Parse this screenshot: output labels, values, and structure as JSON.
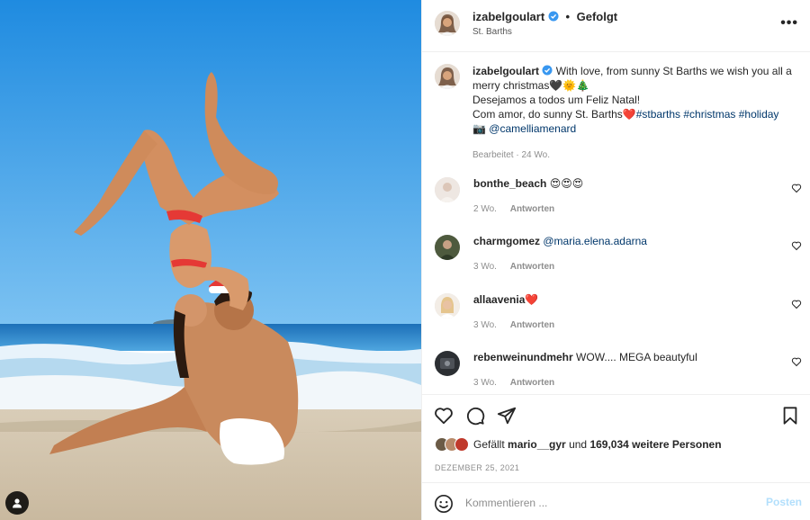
{
  "post": {
    "username": "izabelgoulart",
    "separator": "•",
    "follow_label": "Gefolgt",
    "location": "St. Barths",
    "more_icon": "more-horizontal-icon"
  },
  "caption": {
    "username": "izabelgoulart",
    "line1": " With love, from sunny St Barths we wish you all a merry christmas🖤🌞🎄",
    "line2": "Desejamos a todos um Feliz Natal!",
    "line3": "Com amor, do sunny St. Barths❤️",
    "hashtags": "#stbarths #christmas #holiday",
    "camera_emoji": "📷",
    "mention": "@camelliamenard",
    "meta": "Bearbeitet · 24 Wo."
  },
  "comments": [
    {
      "username": "bonthe_beach",
      "text": "😍😍😍",
      "time": "2 Wo.",
      "reply": "Antworten"
    },
    {
      "username": "charmgomez",
      "text": "@maria.elena.adarna",
      "time": "3 Wo.",
      "reply": "Antworten"
    },
    {
      "username": "allaavenia",
      "text": "❤️",
      "time": "3 Wo.",
      "reply": "Antworten"
    },
    {
      "username": "rebenweinundmehr",
      "text": "WOW.... MEGA beautyful",
      "time": "3 Wo.",
      "reply": "Antworten"
    }
  ],
  "likes": {
    "prefix": "Gefällt",
    "user": "mario__gyr",
    "middle": "und",
    "count": "169,034 weitere Personen"
  },
  "date": "DEZEMBER 25, 2021",
  "composer": {
    "placeholder": "Kommentieren ...",
    "post_label": "Posten"
  },
  "colors": {
    "sky": "#3d9ee8",
    "sea": "#2f8fd4",
    "sand": "#e8dcc8",
    "link": "#00376b",
    "verified": "#3897f0",
    "post_disabled": "#b2dffc"
  }
}
